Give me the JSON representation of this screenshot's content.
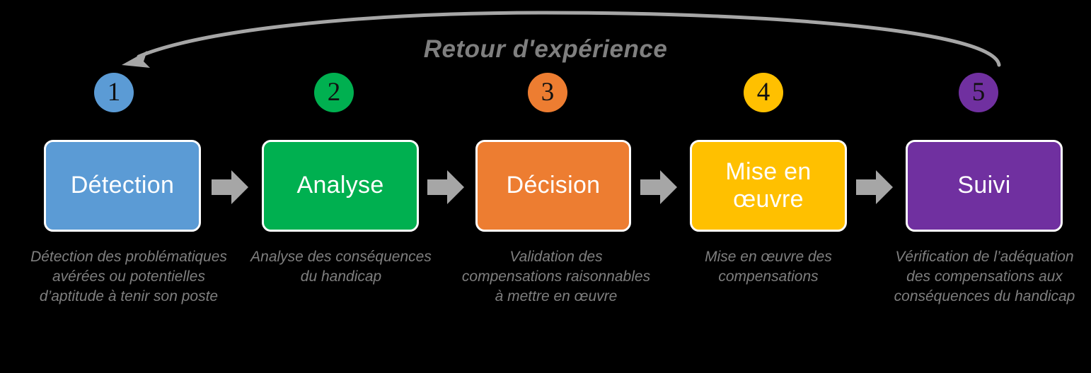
{
  "title": "Retour d'expérience",
  "colors": {
    "background": "#000000",
    "text_gray": "#7f7f7f",
    "arrow_gray": "#a6a6a6",
    "box_border": "#ffffff",
    "step1": "#5b9bd5",
    "step2": "#00b050",
    "step3": "#ed7d31",
    "step4": "#ffc000",
    "step5": "#7030a0"
  },
  "steps": [
    {
      "number": "1",
      "label": "Détection",
      "caption": "Détection des problématiques avérées ou potentielles d’aptitude à tenir son poste",
      "color": "#5b9bd5"
    },
    {
      "number": "2",
      "label": "Analyse",
      "caption": "Analyse des conséquences du handicap",
      "color": "#00b050"
    },
    {
      "number": "3",
      "label": "Décision",
      "caption": "Validation des compensations raisonnables à mettre en œuvre",
      "color": "#ed7d31"
    },
    {
      "number": "4",
      "label": "Mise en œuvre",
      "caption": "Mise en œuvre des compensations",
      "color": "#ffc000"
    },
    {
      "number": "5",
      "label": "Suivi",
      "caption": "Vérification de l’adéquation des compensations aux conséquences du handicap",
      "color": "#7030a0"
    }
  ],
  "connectors": [
    {
      "name": "arrow-1-to-2"
    },
    {
      "name": "arrow-2-to-3"
    },
    {
      "name": "arrow-3-to-4"
    },
    {
      "name": "arrow-4-to-5"
    }
  ]
}
